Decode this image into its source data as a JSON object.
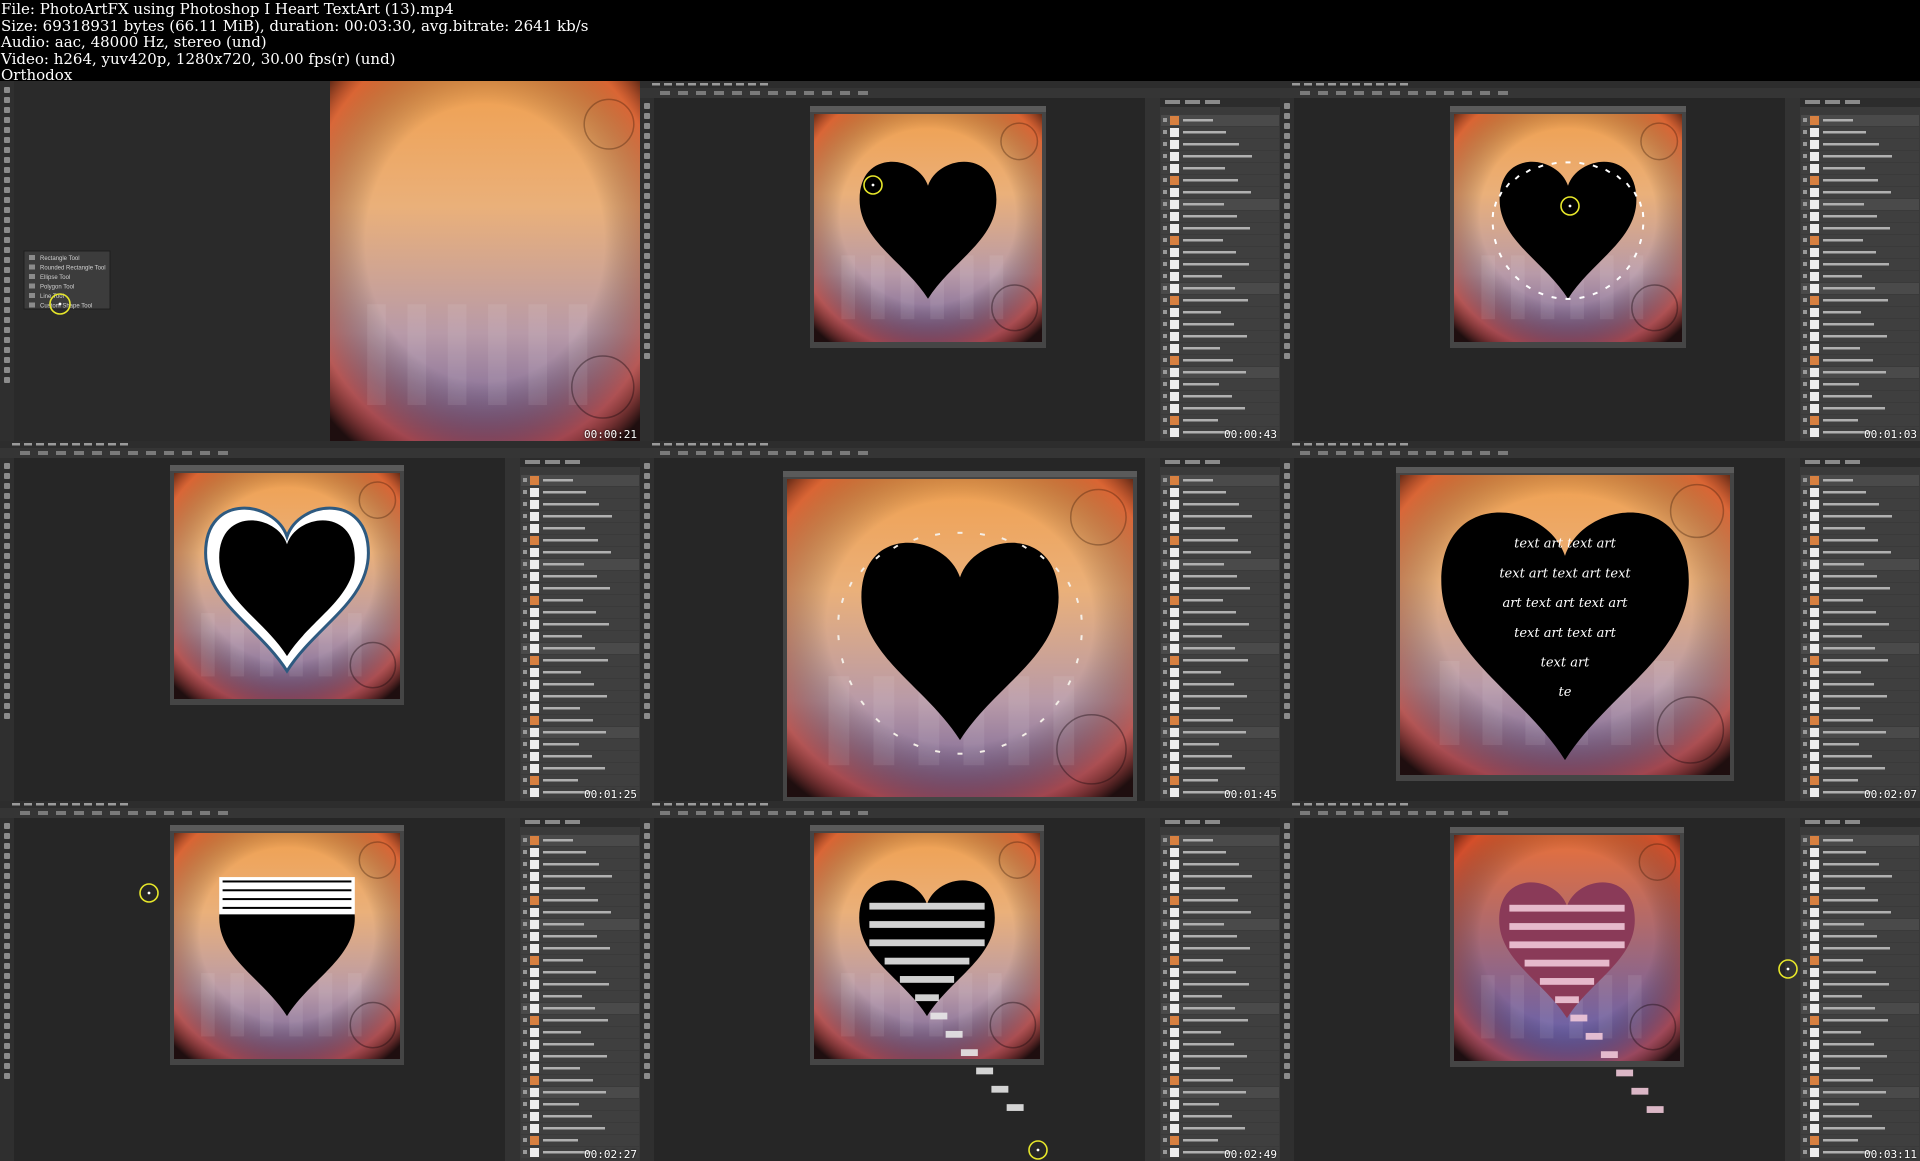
{
  "header": {
    "line_file": "File: PhotoArtFX using Photoshop I Heart TextArt (13).mp4",
    "line_size": "Size: 69318931 bytes (66.11 MiB), duration: 00:03:30, avg.bitrate: 2641 kb/s",
    "line_audio": "Audio: aac, 48000 Hz, stereo (und)",
    "line_video": "Video: h264, yuv420p, 1280x720, 30.00 fps(r) (und)",
    "line_author": "Orthodox"
  },
  "thumbnails": [
    {
      "timestamp": "00:00:21"
    },
    {
      "timestamp": "00:00:43"
    },
    {
      "timestamp": "00:01:03"
    },
    {
      "timestamp": "00:01:25"
    },
    {
      "timestamp": "00:01:45"
    },
    {
      "timestamp": "00:02:07"
    },
    {
      "timestamp": "00:02:27"
    },
    {
      "timestamp": "00:02:49"
    },
    {
      "timestamp": "00:03:11"
    }
  ],
  "tool_flyout": {
    "items": [
      "Rectangle Tool",
      "Rounded Rectangle Tool",
      "Ellipse Tool",
      "Polygon Tool",
      "Line Tool",
      "Custom Shape Tool"
    ]
  },
  "text_art": {
    "rows": [
      "text art    text art",
      "text art text art text",
      "art text art text art",
      "text art text art",
      "text art",
      "te"
    ]
  },
  "colors": {
    "workspace": "#262626",
    "panel": "#383838",
    "canvas_top": "#e8602c",
    "canvas_bottom": "#8a6a9a",
    "highlight_circle": "#e6e62a"
  },
  "icons": [
    "cursor-highlight-icon",
    "move-tool-icon",
    "shape-tool-icon",
    "eye-icon",
    "layer-thumbnail-icon"
  ]
}
